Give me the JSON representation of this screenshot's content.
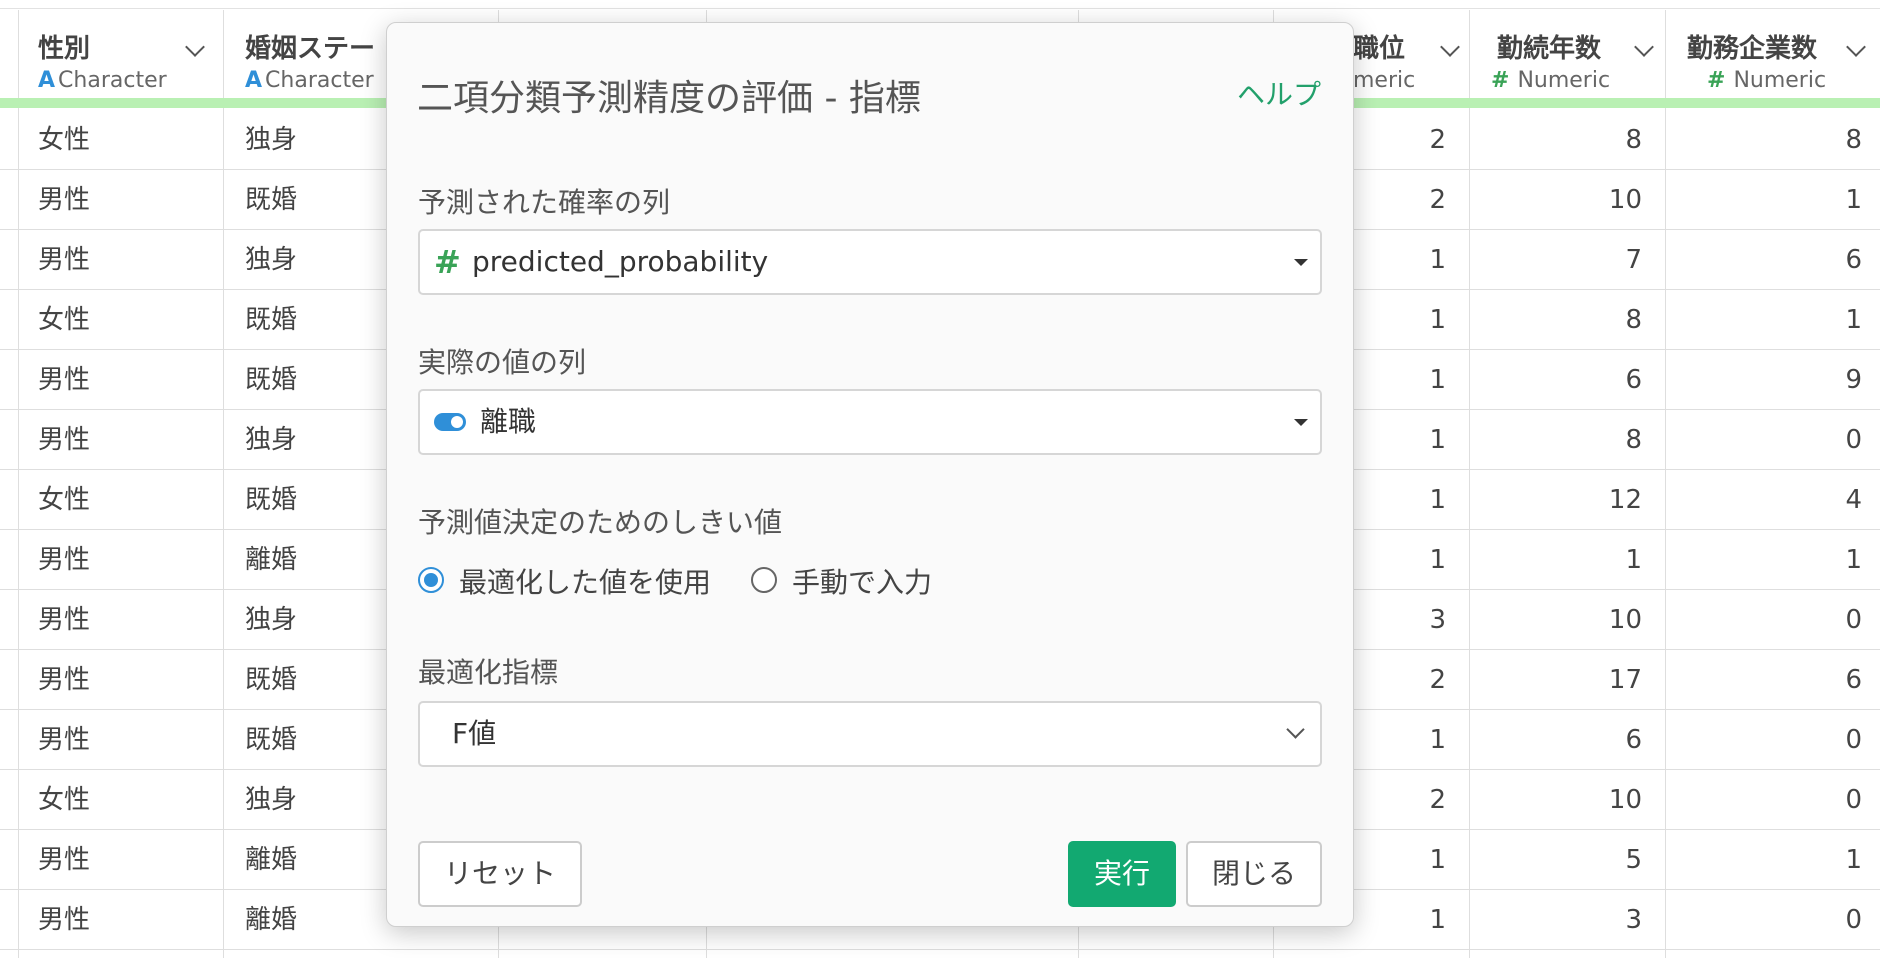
{
  "columns": [
    {
      "name": "性別",
      "type": "Character",
      "type_icon": "A"
    },
    {
      "name": "婚姻ステー",
      "type": "Character",
      "type_icon": "A"
    },
    {
      "name": "",
      "type": "",
      "type_icon": ""
    },
    {
      "name": "",
      "type": "",
      "type_icon": ""
    },
    {
      "name": "",
      "type": "",
      "type_icon": ""
    },
    {
      "name": "職位",
      "type": "meric",
      "type_icon": ""
    },
    {
      "name": "勤続年数",
      "type": "Numeric",
      "type_icon": "#"
    },
    {
      "name": "勤務企業数",
      "type": "Numeric",
      "type_icon": "#"
    }
  ],
  "rows": [
    {
      "gender": "女性",
      "marital": "独身",
      "position": "2",
      "tenure": "8",
      "companies": "8"
    },
    {
      "gender": "男性",
      "marital": "既婚",
      "position": "2",
      "tenure": "10",
      "companies": "1"
    },
    {
      "gender": "男性",
      "marital": "独身",
      "position": "1",
      "tenure": "7",
      "companies": "6"
    },
    {
      "gender": "女性",
      "marital": "既婚",
      "position": "1",
      "tenure": "8",
      "companies": "1"
    },
    {
      "gender": "男性",
      "marital": "既婚",
      "position": "1",
      "tenure": "6",
      "companies": "9"
    },
    {
      "gender": "男性",
      "marital": "独身",
      "position": "1",
      "tenure": "8",
      "companies": "0"
    },
    {
      "gender": "女性",
      "marital": "既婚",
      "position": "1",
      "tenure": "12",
      "companies": "4"
    },
    {
      "gender": "男性",
      "marital": "離婚",
      "position": "1",
      "tenure": "1",
      "companies": "1"
    },
    {
      "gender": "男性",
      "marital": "独身",
      "position": "3",
      "tenure": "10",
      "companies": "0"
    },
    {
      "gender": "男性",
      "marital": "既婚",
      "position": "2",
      "tenure": "17",
      "companies": "6"
    },
    {
      "gender": "男性",
      "marital": "既婚",
      "position": "1",
      "tenure": "6",
      "companies": "0"
    },
    {
      "gender": "女性",
      "marital": "独身",
      "position": "2",
      "tenure": "10",
      "companies": "0"
    },
    {
      "gender": "男性",
      "marital": "離婚",
      "position": "1",
      "tenure": "5",
      "companies": "1"
    },
    {
      "gender": "男性",
      "marital": "離婚",
      "position": "1",
      "tenure": "3",
      "companies": "0"
    }
  ],
  "dialog": {
    "title": "二項分類予測精度の評価 - 指標",
    "help": "ヘルプ",
    "predicted_label": "予測された確率の列",
    "predicted_value": "predicted_probability",
    "predicted_icon": "#",
    "actual_label": "実際の値の列",
    "actual_value": "離職",
    "threshold_label": "予測値決定のためのしきい値",
    "radio_optimized": "最適化した値を使用",
    "radio_manual": "手動で入力",
    "radio_selected": "optimized",
    "metric_label": "最適化指標",
    "metric_value": "F値",
    "reset": "リセット",
    "run": "実行",
    "close": "閉じる"
  },
  "colors": {
    "accent_green": "#12a971",
    "header_band": "#b9f0b3",
    "character_icon": "#2f8fd8",
    "numeric_icon": "#3aa357",
    "radio_active": "#2f8fd8"
  }
}
